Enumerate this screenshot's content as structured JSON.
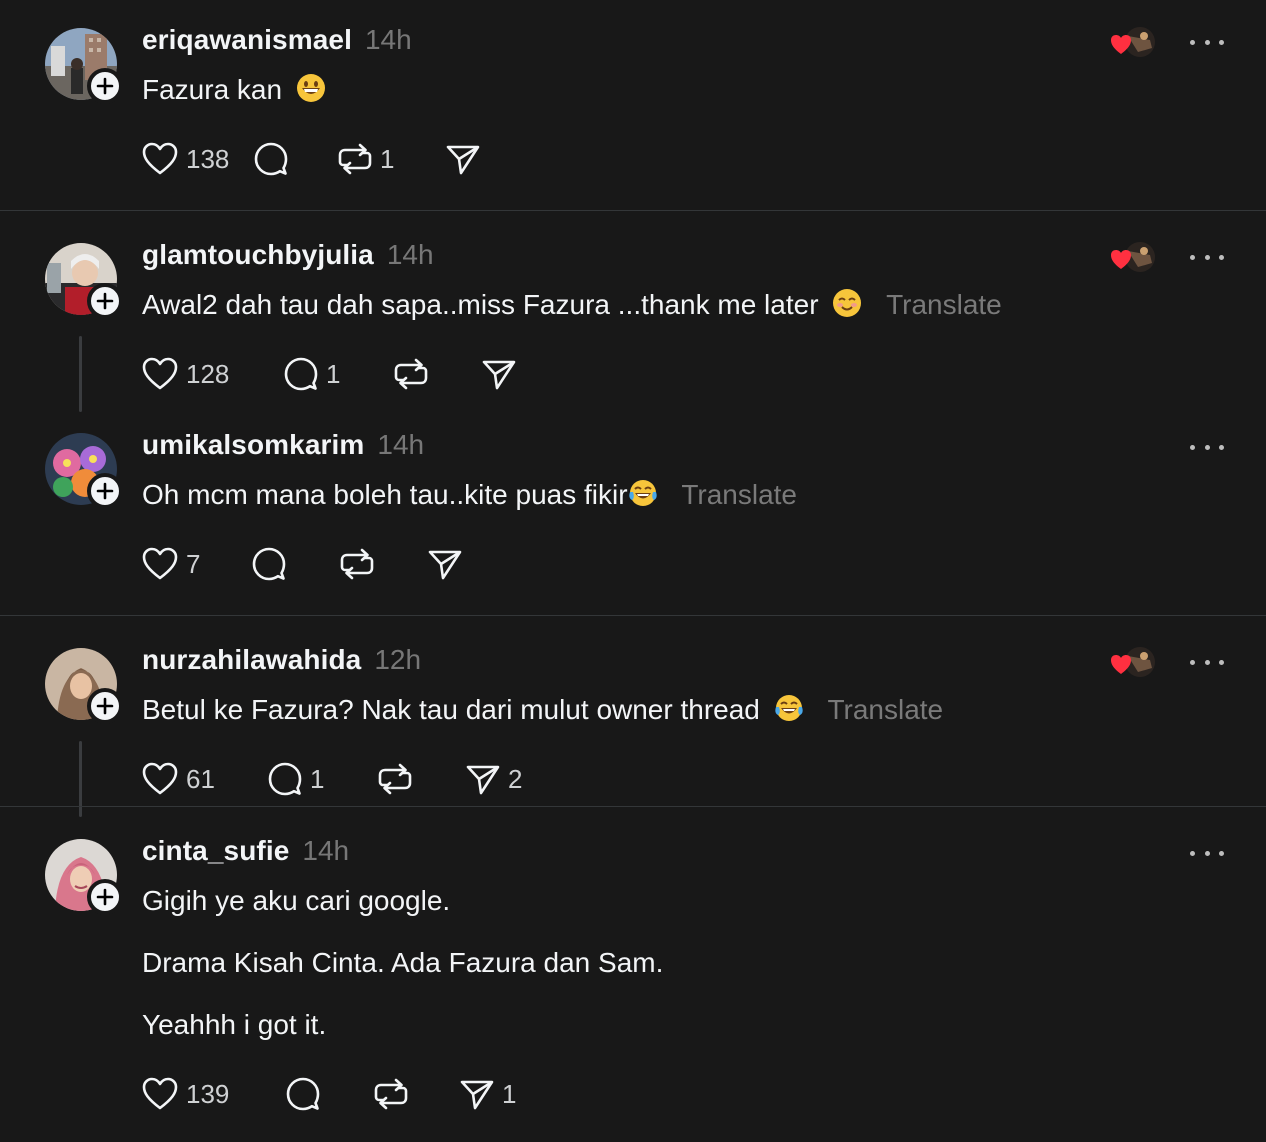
{
  "posts": [
    {
      "username": "eriqawanismael",
      "time": "14h",
      "text": "Fazura kan",
      "emoji_icon": "grinning-face-icon",
      "translate": "",
      "likes": "138",
      "replies": "",
      "reposts": "1",
      "shares": "",
      "liked_by_owner": true
    },
    {
      "username": "glamtouchbyjulia",
      "time": "14h",
      "text": "Awal2 dah tau dah sapa..miss Fazura ...thank me later",
      "emoji_icon": "smiling-face-icon",
      "translate": "Translate",
      "likes": "128",
      "replies": "1",
      "reposts": "",
      "shares": "",
      "liked_by_owner": true
    },
    {
      "username": "umikalsomkarim",
      "time": "14h",
      "text": "Oh mcm mana boleh tau..kite puas fikir",
      "emoji_icon": "tears-of-joy-icon",
      "translate": "Translate",
      "likes": "7",
      "replies": "",
      "reposts": "",
      "shares": "",
      "liked_by_owner": false
    },
    {
      "username": "nurzahilawahida",
      "time": "12h",
      "text": "Betul ke Fazura? Nak tau dari mulut owner thread",
      "emoji_icon": "tears-of-joy-icon",
      "translate": "Translate",
      "likes": "61",
      "replies": "1",
      "reposts": "",
      "shares": "2",
      "liked_by_owner": true
    },
    {
      "username": "cinta_sufie",
      "time": "14h",
      "lines": [
        "Gigih ye aku cari google.",
        "Drama Kisah Cinta. Ada Fazura dan Sam.",
        "Yeahhh i got it."
      ],
      "translate": "",
      "likes": "139",
      "replies": "",
      "reposts": "",
      "shares": "1",
      "liked_by_owner": false
    }
  ],
  "colors": {
    "background": "#181818",
    "text": "#f3f5f7",
    "muted": "#777777",
    "heart_red": "#ff3040"
  }
}
